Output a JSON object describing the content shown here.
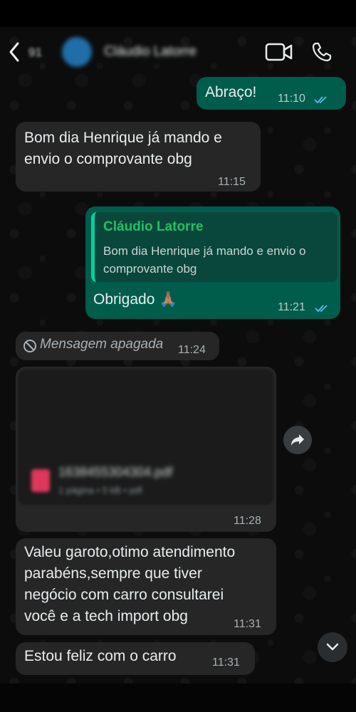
{
  "header": {
    "back_label": "‹",
    "unread_count": "91",
    "contact_name": "Cláudio Latorre"
  },
  "messages": [
    {
      "direction": "out",
      "text": "Abraço!",
      "time": "11:10",
      "status": "read"
    },
    {
      "direction": "in",
      "text_lines": [
        "Bom dia Henrique já mando e",
        "envio o comprovante obg"
      ],
      "time": "11:15"
    },
    {
      "direction": "out",
      "quote_author": "Cláudio Latorre",
      "quote_lines": [
        "Bom dia Henrique já mando e envio o",
        "comprovante obg"
      ],
      "text": "Obrigado 🙏🏽",
      "time": "11:21",
      "status": "read"
    },
    {
      "direction": "in",
      "deleted_text": "Mensagem apagada",
      "time": "11:24"
    },
    {
      "direction": "in",
      "document": {
        "file_name": "1638455304304.pdf",
        "meta": "1 página • 5 kB • pdf"
      },
      "time": "11:28"
    },
    {
      "direction": "in",
      "text_lines": [
        "Valeu garoto,otimo atendimento",
        "parabéns,sempre que tiver",
        "negócio com carro consultarei",
        "você e a tech import obg"
      ],
      "time": "11:31"
    },
    {
      "direction": "in",
      "text": "Estou feliz com o carro",
      "time": "11:31"
    }
  ],
  "icons": {
    "back": "chevron-left-icon",
    "video": "video-camera-icon",
    "phone": "phone-icon",
    "deleted": "blocked-icon",
    "forward": "forward-icon",
    "scroll": "chevron-down-icon",
    "read": "double-check-icon"
  },
  "colors": {
    "outgoing_bubble": "#005c4b",
    "incoming_bubble": "#262626",
    "quote_author": "#21c063",
    "read_ticks": "#53bdeb"
  }
}
